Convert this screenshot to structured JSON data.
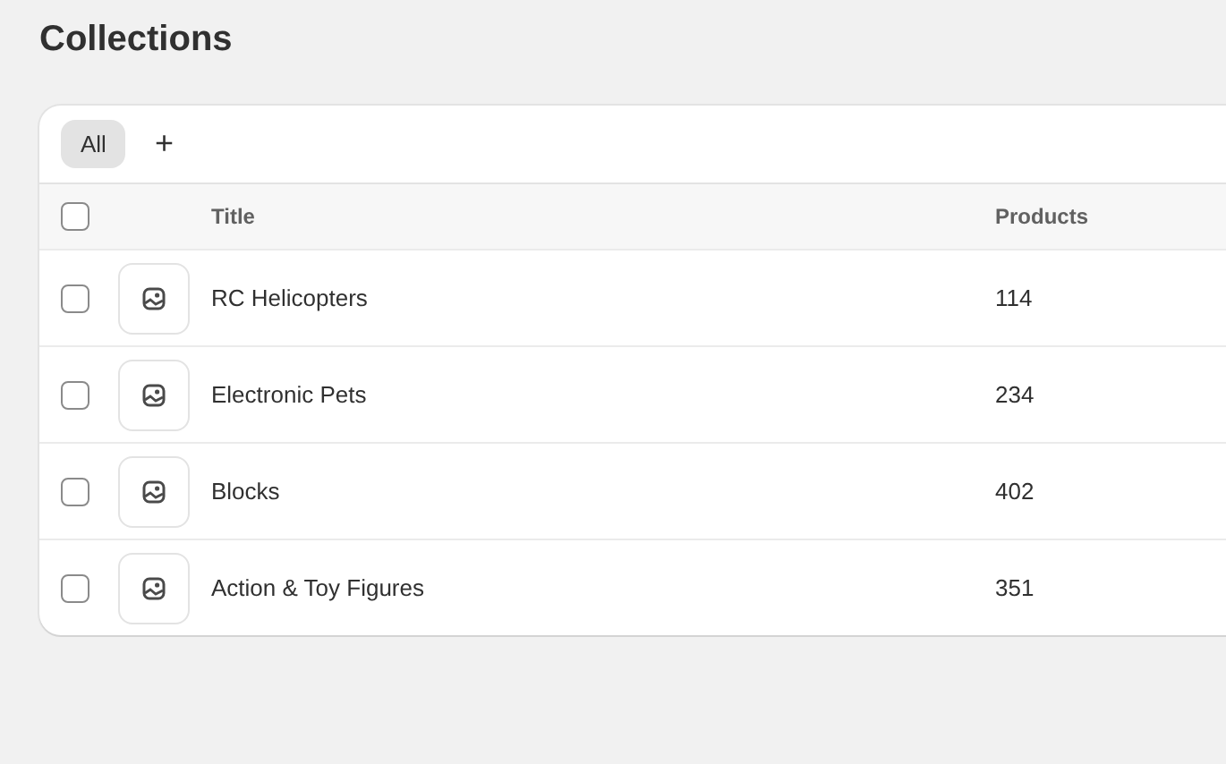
{
  "page": {
    "title": "Collections"
  },
  "tabs": [
    {
      "label": "All",
      "selected": true
    }
  ],
  "add_tab": {
    "label": "+"
  },
  "table": {
    "select_all": {
      "checked": false
    },
    "columns": [
      "Title",
      "Products"
    ],
    "rows": [
      {
        "title": "RC Helicopters",
        "products": "114",
        "checked": false
      },
      {
        "title": "Electronic Pets",
        "products": "234",
        "checked": false
      },
      {
        "title": "Blocks",
        "products": "402",
        "checked": false
      },
      {
        "title": "Action & Toy Figures",
        "products": "351",
        "checked": false
      }
    ]
  }
}
